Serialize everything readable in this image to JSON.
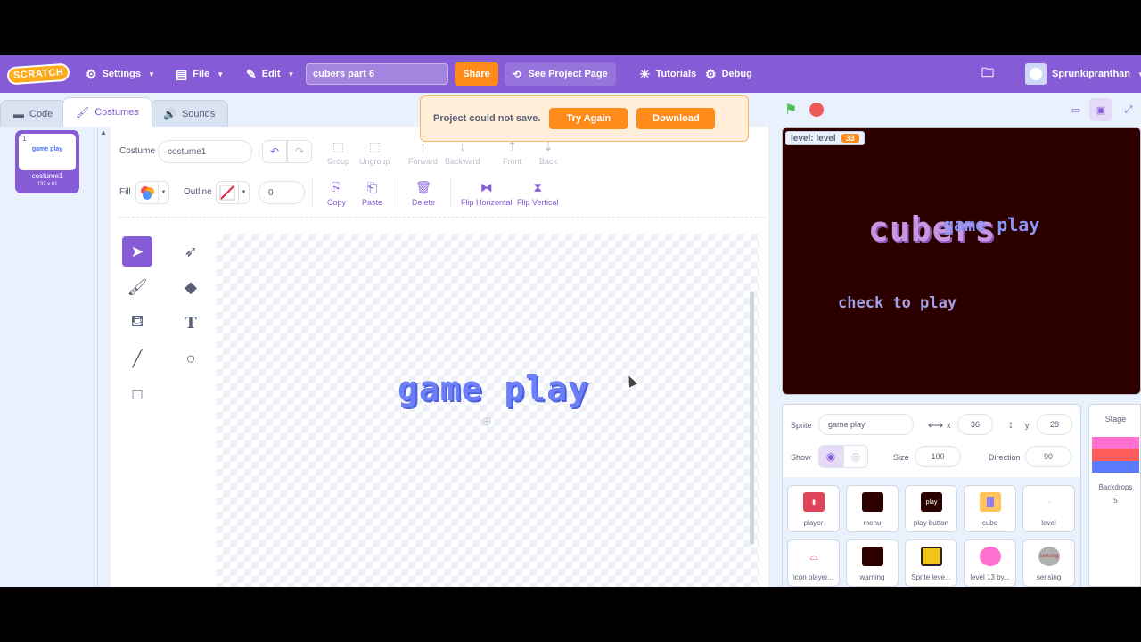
{
  "menubar": {
    "logo": "SCRATCH",
    "settings": "Settings",
    "file": "File",
    "edit": "Edit",
    "project_title": "cubers part 6",
    "share": "Share",
    "see_project_page": "See Project Page",
    "tutorials": "Tutorials",
    "debug": "Debug",
    "username": "Sprunkipranthan",
    "colors": {
      "bar": "#855cd6",
      "share": "#ff8c1a"
    }
  },
  "tabs": {
    "code": "Code",
    "costumes": "Costumes",
    "sounds": "Sounds",
    "active": "costumes"
  },
  "alert": {
    "message": "Project could not save.",
    "try_again": "Try Again",
    "download": "Download"
  },
  "costume_list": {
    "items": [
      {
        "number": "1",
        "thumb_text": "game play",
        "name": "costume1",
        "size": "132 x 61",
        "selected": true
      }
    ]
  },
  "paint_editor": {
    "costume_label": "Costume",
    "costume_name": "costume1",
    "group": "Group",
    "ungroup": "Ungroup",
    "forward": "Forward",
    "backward": "Backward",
    "front": "Front",
    "back": "Back",
    "fill_label": "Fill",
    "outline_label": "Outline",
    "outline_width": "0",
    "copy": "Copy",
    "paste": "Paste",
    "delete": "Delete",
    "flip_horizontal": "Flip Horizontal",
    "flip_vertical": "Flip Vertical",
    "canvas_text": "game play",
    "tools": [
      "select-icon",
      "reshape-icon",
      "brush-icon",
      "eraser-icon",
      "fill-icon",
      "text-icon",
      "line-icon",
      "circle-icon",
      "rectangle-icon"
    ]
  },
  "stage": {
    "monitor_label": "level: level",
    "monitor_value": "33",
    "title_text": "cubers",
    "overlay_text": "game play",
    "check_text": "check to play",
    "background": "#2d0000"
  },
  "sprite_info": {
    "sprite_label": "Sprite",
    "sprite_name": "game play",
    "x_label": "x",
    "x": "36",
    "y_label": "y",
    "y": "28",
    "show_label": "Show",
    "size_label": "Size",
    "size": "100",
    "direction_label": "Direction",
    "direction": "90"
  },
  "sprites": [
    {
      "name": "player",
      "thumb": "",
      "color": "#e0445a"
    },
    {
      "name": "menu",
      "thumb": "",
      "color": "#2d0000"
    },
    {
      "name": "play button",
      "thumb": "play",
      "color": "#2d0000"
    },
    {
      "name": "cube",
      "thumb": "",
      "color": "#ffc35c"
    },
    {
      "name": "level",
      "thumb": "·",
      "color": "#ffffff"
    },
    {
      "name": "icon player...",
      "thumb": "",
      "color": "#ffffff"
    },
    {
      "name": "warning",
      "thumb": "",
      "color": "#2d0000"
    },
    {
      "name": "Sprite leve...",
      "thumb": "",
      "color": "#f0c419"
    },
    {
      "name": "level 13 by...",
      "thumb": "",
      "color": "#ff6fcf"
    },
    {
      "name": "sensing",
      "thumb": "sensing",
      "color": "#b0b0b0"
    }
  ],
  "stage_panel": {
    "label": "Stage",
    "backdrops_label": "Backdrops",
    "backdrops_count": "5"
  }
}
